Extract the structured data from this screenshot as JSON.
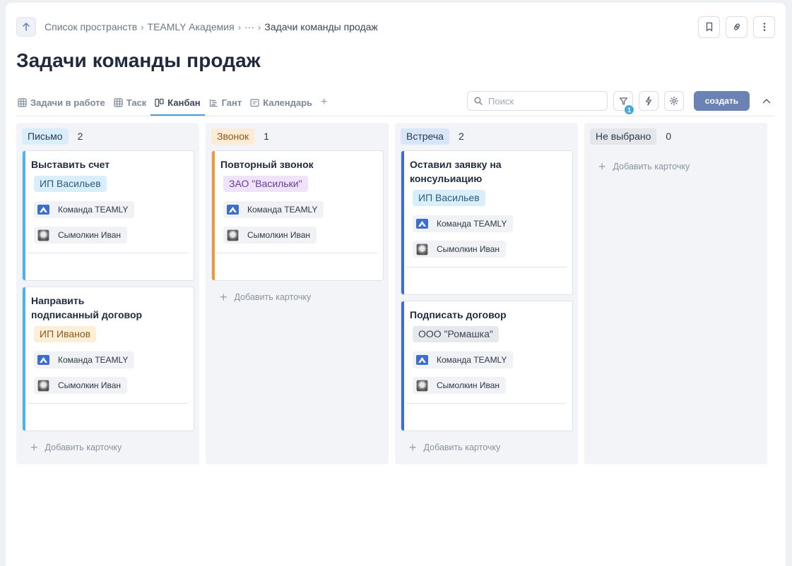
{
  "breadcrumb": {
    "items": [
      "Список пространств",
      "TEAMLY Академия",
      "···",
      "Задачи команды продаж"
    ]
  },
  "page_title": "Задачи команды продаж",
  "tabs": [
    {
      "label": "Задачи в работе",
      "icon": "table-icon"
    },
    {
      "label": "Таск",
      "icon": "table-icon"
    },
    {
      "label": "Канбан",
      "icon": "kanban-icon",
      "active": true
    },
    {
      "label": "Гант",
      "icon": "gantt-icon"
    },
    {
      "label": "Календарь",
      "icon": "calendar-icon"
    }
  ],
  "toolbar": {
    "search_placeholder": "Поиск",
    "filter_badge": "1",
    "create_label": "создать"
  },
  "add_card_label": "Добавить карточку",
  "columns": [
    {
      "label": "Письмо",
      "count": "2",
      "tag_bg": "#d9eefb",
      "tag_color": "#2b3b52",
      "accent": "#4fb3e3",
      "cards": [
        {
          "title": "Выставить счет",
          "company": "ИП Васильев",
          "company_bg": "#d9eefb",
          "company_color": "#2f5b80",
          "team": "Команда TEAMLY",
          "assignee": "Сымолкин Иван"
        },
        {
          "title": "Направить подписанный договор",
          "company": "ИП Иванов",
          "company_bg": "#fdeed8",
          "company_color": "#8a5a1c",
          "team": "Команда TEAMLY",
          "assignee": "Сымолкин Иван"
        }
      ]
    },
    {
      "label": "Звонок",
      "count": "1",
      "tag_bg": "#fdebd6",
      "tag_color": "#8a5a1c",
      "accent": "#e89a3c",
      "cards": [
        {
          "title": "Повторный звонок",
          "company": "ЗАО \"Васильки\"",
          "company_bg": "#efe3fb",
          "company_color": "#6a3e94",
          "team": "Команда TEAMLY",
          "assignee": "Сымолкин Иван"
        }
      ]
    },
    {
      "label": "Встреча",
      "count": "2",
      "tag_bg": "#d9e6fa",
      "tag_color": "#2b3b52",
      "accent": "#3d6ecf",
      "cards": [
        {
          "title": "Оставил заявку на консульиацию",
          "company": "ИП Васильев",
          "company_bg": "#d9eefb",
          "company_color": "#2f5b80",
          "team": "Команда TEAMLY",
          "assignee": "Сымолкин Иван"
        },
        {
          "title": "Подписать договор",
          "company": "ООО \"Ромашка\"",
          "company_bg": "#e6e8ec",
          "company_color": "#3a4556",
          "team": "Команда TEAMLY",
          "assignee": "Сымолкин Иван"
        }
      ]
    },
    {
      "label": "Не выбрано",
      "count": "0",
      "tag_bg": "#e4e6ea",
      "tag_color": "#2b3b52",
      "accent": "#9aa2ae",
      "cards": []
    }
  ]
}
